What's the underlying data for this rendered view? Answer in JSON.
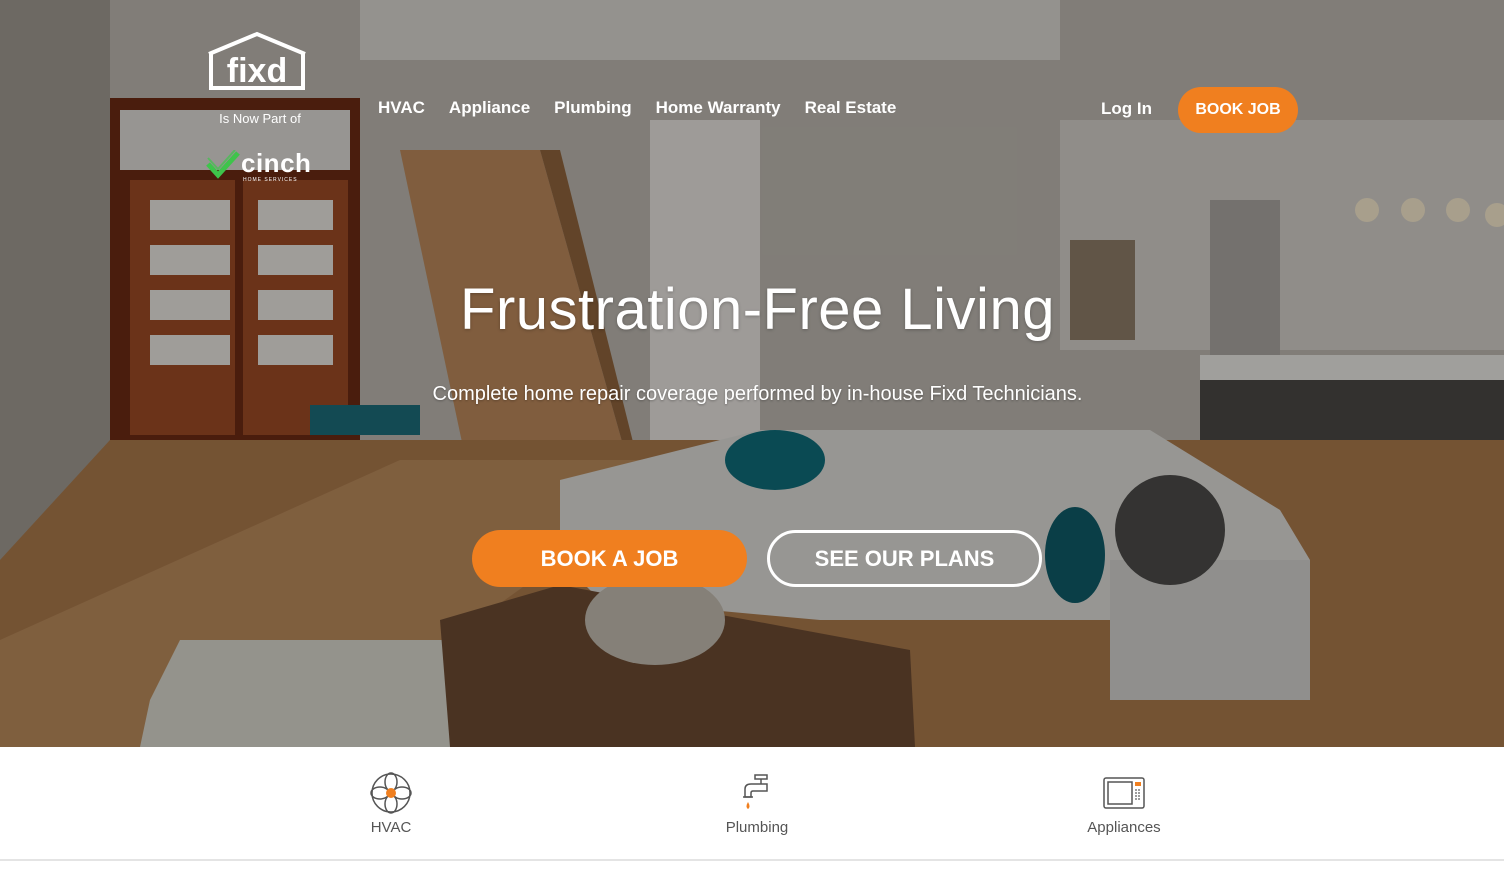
{
  "brand": {
    "logo_text": "fixd",
    "tagline": "Is Now Part of",
    "partner_name": "cinch",
    "partner_sub": "HOME SERVICES"
  },
  "nav": {
    "links": [
      "HVAC",
      "Appliance",
      "Plumbing",
      "Home Warranty",
      "Real Estate"
    ],
    "login_label": "Log In",
    "book_label": "BOOK JOB"
  },
  "hero": {
    "headline": "Frustration-Free Living",
    "subheadline": "Complete home repair coverage performed by in-house Fixd Technicians.",
    "primary_cta": "BOOK A JOB",
    "secondary_cta": "SEE OUR PLANS"
  },
  "services": [
    {
      "label": "HVAC",
      "icon": "fan-icon"
    },
    {
      "label": "Plumbing",
      "icon": "faucet-icon"
    },
    {
      "label": "Appliances",
      "icon": "microwave-icon"
    }
  ],
  "colors": {
    "accent": "#f07f1f",
    "cinch_green": "#3ec44b",
    "white": "#ffffff",
    "service_label": "#555555"
  }
}
